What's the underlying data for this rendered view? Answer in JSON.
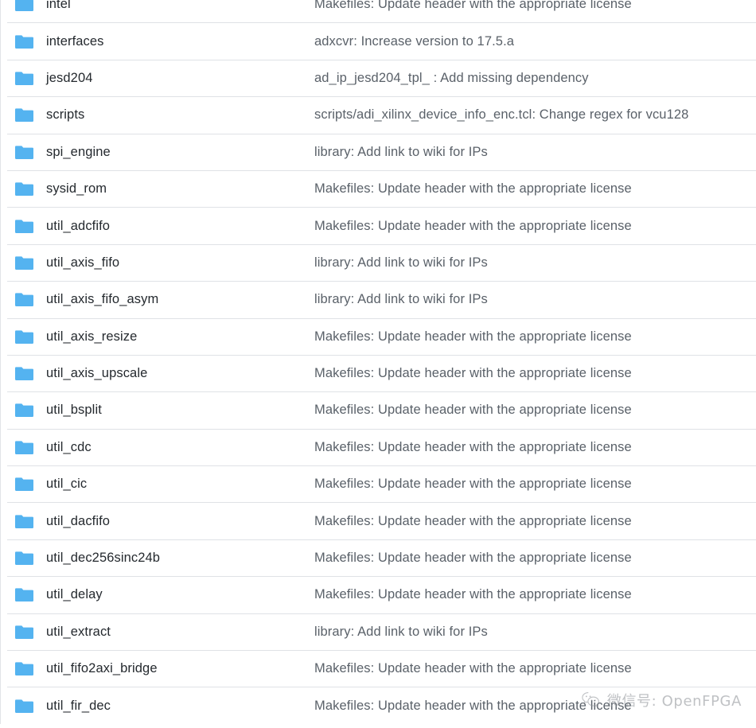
{
  "view": {
    "name": "repository-file-listing",
    "accent_color": "#54b3f0",
    "divider_color": "#dfe2e6",
    "filename_color": "#24292e",
    "commit_color": "#5a6169",
    "background_color": "#ffffff",
    "folder_icon_name": "folder-icon"
  },
  "columns": {
    "name": "",
    "commit_message": ""
  },
  "rows": [
    {
      "icon": "folder-icon",
      "name": "intel",
      "commit": "Makefiles: Update header with the appropriate license"
    },
    {
      "icon": "folder-icon",
      "name": "interfaces",
      "commit": "adxcvr: Increase version to 17.5.a"
    },
    {
      "icon": "folder-icon",
      "name": "jesd204",
      "commit": "ad_ip_jesd204_tpl_ : Add missing dependency"
    },
    {
      "icon": "folder-icon",
      "name": "scripts",
      "commit": "scripts/adi_xilinx_device_info_enc.tcl: Change regex for vcu128"
    },
    {
      "icon": "folder-icon",
      "name": "spi_engine",
      "commit": "library: Add link to wiki for IPs"
    },
    {
      "icon": "folder-icon",
      "name": "sysid_rom",
      "commit": "Makefiles: Update header with the appropriate license"
    },
    {
      "icon": "folder-icon",
      "name": "util_adcfifo",
      "commit": "Makefiles: Update header with the appropriate license"
    },
    {
      "icon": "folder-icon",
      "name": "util_axis_fifo",
      "commit": "library: Add link to wiki for IPs"
    },
    {
      "icon": "folder-icon",
      "name": "util_axis_fifo_asym",
      "commit": "library: Add link to wiki for IPs"
    },
    {
      "icon": "folder-icon",
      "name": "util_axis_resize",
      "commit": "Makefiles: Update header with the appropriate license"
    },
    {
      "icon": "folder-icon",
      "name": "util_axis_upscale",
      "commit": "Makefiles: Update header with the appropriate license"
    },
    {
      "icon": "folder-icon",
      "name": "util_bsplit",
      "commit": "Makefiles: Update header with the appropriate license"
    },
    {
      "icon": "folder-icon",
      "name": "util_cdc",
      "commit": "Makefiles: Update header with the appropriate license"
    },
    {
      "icon": "folder-icon",
      "name": "util_cic",
      "commit": "Makefiles: Update header with the appropriate license"
    },
    {
      "icon": "folder-icon",
      "name": "util_dacfifo",
      "commit": "Makefiles: Update header with the appropriate license"
    },
    {
      "icon": "folder-icon",
      "name": "util_dec256sinc24b",
      "commit": "Makefiles: Update header with the appropriate license"
    },
    {
      "icon": "folder-icon",
      "name": "util_delay",
      "commit": "Makefiles: Update header with the appropriate license"
    },
    {
      "icon": "folder-icon",
      "name": "util_extract",
      "commit": "library: Add link to wiki for IPs"
    },
    {
      "icon": "folder-icon",
      "name": "util_fifo2axi_bridge",
      "commit": "Makefiles: Update header with the appropriate license"
    },
    {
      "icon": "folder-icon",
      "name": "util_fir_dec",
      "commit": "Makefiles: Update header with the appropriate license"
    }
  ],
  "watermark": {
    "icon": "wechat-icon",
    "text": "微信号: OpenFPGA"
  }
}
